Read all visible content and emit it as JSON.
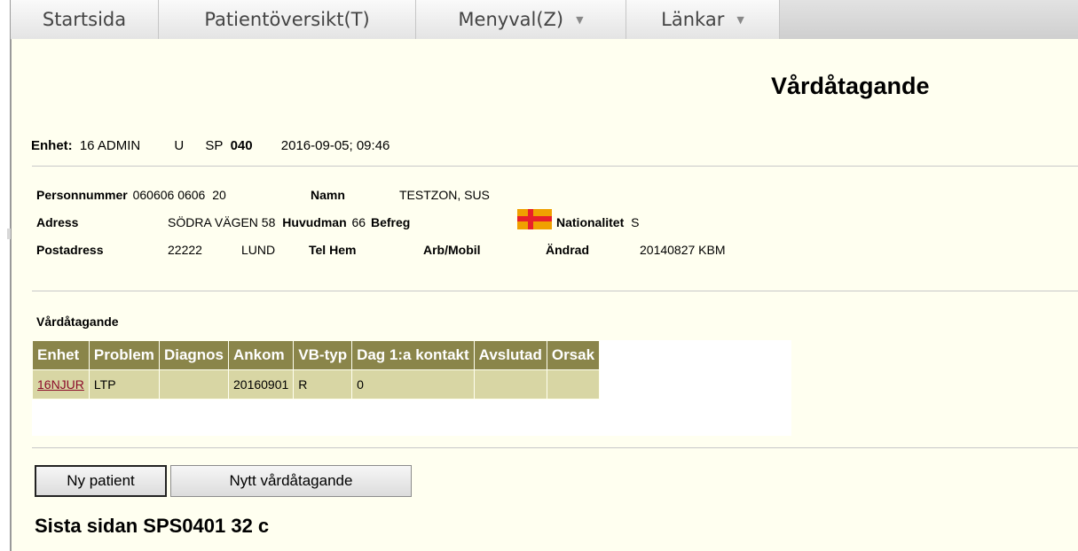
{
  "menubar": {
    "items": [
      {
        "label": "Startsida",
        "dropdown": false
      },
      {
        "label": "Patientöversikt(T)",
        "dropdown": false
      },
      {
        "label": "Menyval(Z)",
        "dropdown": true
      },
      {
        "label": "Länkar",
        "dropdown": true
      }
    ]
  },
  "page": {
    "title": "Vårdåtagande"
  },
  "unit": {
    "label": "Enhet:",
    "value": "16 ADMIN",
    "mode": "U",
    "sp_label": "SP",
    "sp_value": "040",
    "timestamp": "2016-09-05; 09:46"
  },
  "patient": {
    "personnummer_label": "Personnummer",
    "personnummer": "060606 0606",
    "age": "20",
    "namn_label": "Namn",
    "namn": "TESTZON, SUS",
    "adress_label": "Adress",
    "adress": "SÖDRA VÄGEN 58",
    "huvudman_label": "Huvudman",
    "huvudman": "66",
    "befreg_label": "Befreg",
    "nationalitet_label": "Nationalitet",
    "nationalitet": "S",
    "postadress_label": "Postadress",
    "postnummer": "22222",
    "ort": "LUND",
    "telhem_label": "Tel Hem",
    "arbmobil_label": "Arb/Mobil",
    "andrad_label": "Ändrad",
    "andrad": "20140827 KBM",
    "flag_icon": "flag-icon",
    "flag_colors": {
      "field": "#f0a000",
      "cross": "#e8202a"
    }
  },
  "vardatagande": {
    "section_title": "Vårdåtagande",
    "columns": [
      "Enhet",
      "Problem",
      "Diagnos",
      "Ankom",
      "VB-typ",
      "Dag 1:a kontakt",
      "Avslutad",
      "Orsak"
    ],
    "rows": [
      {
        "enhet": "16NJUR",
        "problem": "LTP",
        "diagnos": "",
        "ankom": "20160901",
        "vbtyp": "R",
        "dag": "0",
        "avslutad": "",
        "orsak": ""
      }
    ]
  },
  "buttons": {
    "ny_patient": "Ny patient",
    "nytt_vardatagande": "Nytt vårdåtagande"
  },
  "footer": {
    "title": "Sista sidan SPS0401 32 c"
  },
  "colors": {
    "content_bg": "#fffff0",
    "table_header_bg": "#8a854a",
    "table_cell_bg": "#d8d6a4",
    "link": "#8b0a2a"
  }
}
